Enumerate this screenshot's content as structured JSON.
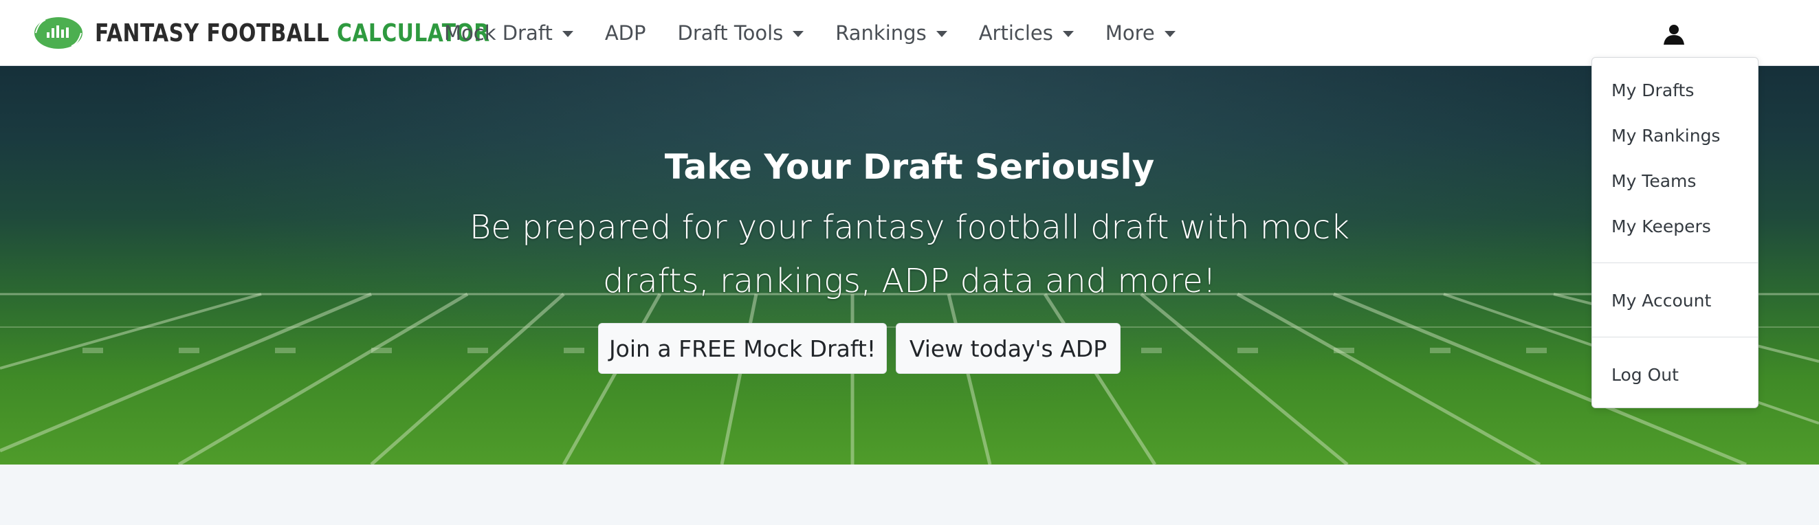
{
  "brand": {
    "part1": "FANTASY FOOTBALL ",
    "part2": "CALCULATOR"
  },
  "nav": [
    {
      "label": "Mock Draft",
      "has_caret": true
    },
    {
      "label": "ADP",
      "has_caret": false
    },
    {
      "label": "Draft Tools",
      "has_caret": true
    },
    {
      "label": "Rankings",
      "has_caret": true
    },
    {
      "label": "Articles",
      "has_caret": true
    },
    {
      "label": "More",
      "has_caret": true
    }
  ],
  "hero": {
    "title": "Take Your Draft Seriously",
    "subtitle": "Be prepared for your fantasy football draft with mock drafts, rankings, ADP data and more!",
    "buttons": [
      "Join a FREE Mock Draft!",
      "View today's ADP"
    ]
  },
  "user_menu": {
    "items": [
      "My Drafts",
      "My Rankings",
      "My Teams",
      "My Keepers"
    ],
    "account": "My Account",
    "logout": "Log Out"
  },
  "colors": {
    "brand_accent": "#2e9a3f",
    "nav_text": "#4a4f55",
    "logo": "#4caf50"
  },
  "icons": [
    "football-logo-icon",
    "user-icon",
    "caret-down-icon"
  ]
}
